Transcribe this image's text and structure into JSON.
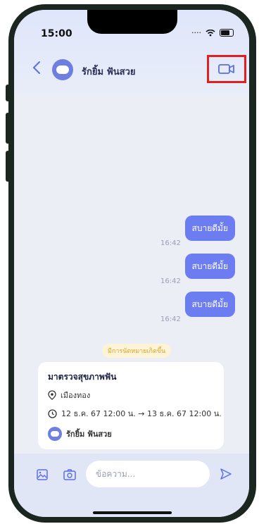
{
  "status_bar": {
    "time": "15:00"
  },
  "header": {
    "contact_name": "รักยิ้ม ฟันสวย"
  },
  "messages": [
    {
      "text": "สบายดีมั้ย",
      "time": "16:42"
    },
    {
      "text": "สบายดีมั้ย",
      "time": "16:42"
    },
    {
      "text": "สบายดีมั้ย",
      "time": "16:42"
    }
  ],
  "system_notice": "มีการนัดหมายเกิดขึ้น",
  "appointment": {
    "title": "มาตรวจสุขภาพฟัน",
    "location": "เมืองทอง",
    "datetime": "12 ธ.ค. 67 12:00 น. → 13 ธ.ค. 67 12:00 น.",
    "person": "รักยิ้ม ฟันสวย"
  },
  "composer": {
    "placeholder": "ข้อความ..."
  },
  "colors": {
    "accent": "#6b7df1",
    "highlight": "#e0201f"
  }
}
